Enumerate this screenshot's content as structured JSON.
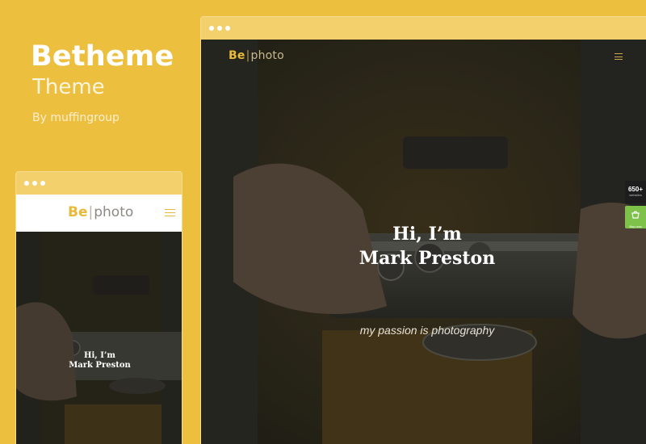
{
  "brand": {
    "title": "Betheme",
    "subtitle": "Theme",
    "byline": "By muffingroup"
  },
  "desktop": {
    "logo_be": "Be",
    "logo_sep": "|",
    "logo_photo": "photo",
    "menu_icon": "hamburger-icon",
    "hero_line1": "Hi, I’m",
    "hero_line2": "Mark Preston",
    "tagline": "my passion is photography"
  },
  "side_badges": {
    "count": "650+",
    "count_label": "websites",
    "buy_icon": "cart-icon",
    "buy_label": "Buy now"
  },
  "mobile": {
    "logo_be": "Be",
    "logo_sep": "|",
    "logo_photo": "photo",
    "menu_icon": "hamburger-icon",
    "hero_line1": "Hi, I’m",
    "hero_line2": "Mark Preston"
  },
  "colors": {
    "background": "#ecbf3f",
    "accent": "#e9b93a",
    "badge_dark": "#1d1d1d",
    "badge_green": "#7ec24a"
  }
}
